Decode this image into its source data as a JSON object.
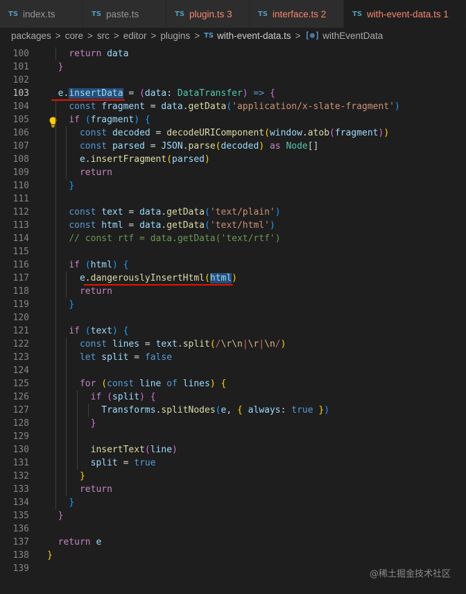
{
  "tabs": [
    {
      "label": "index.ts",
      "badge": "TS",
      "error": false,
      "active": false
    },
    {
      "label": "paste.ts",
      "badge": "TS",
      "error": false,
      "active": false
    },
    {
      "label": "plugin.ts 3",
      "badge": "TS",
      "error": true,
      "active": false
    },
    {
      "label": "interface.ts 2",
      "badge": "TS",
      "error": true,
      "active": false
    },
    {
      "label": "with-event-data.ts 1",
      "badge": "TS",
      "error": true,
      "active": true
    }
  ],
  "breadcrumb": {
    "parts": [
      "packages",
      "core",
      "src",
      "editor",
      "plugins"
    ],
    "separator": ">",
    "file_badge": "TS",
    "file": "with-event-data.ts",
    "symbol": "withEventData"
  },
  "editor": {
    "current_line": 103,
    "lines": [
      {
        "n": "100",
        "indent": 1,
        "tokens": [
          [
            "    ",
            ""
          ],
          [
            "return",
            "ctl"
          ],
          [
            " ",
            ""
          ],
          [
            "data",
            "v"
          ]
        ]
      },
      {
        "n": "101",
        "indent": 0,
        "tokens": [
          [
            "  ",
            ""
          ],
          [
            "}",
            "b2"
          ]
        ]
      },
      {
        "n": "102",
        "indent": 0,
        "tokens": []
      },
      {
        "n": "103",
        "indent": 0,
        "tokens": [
          [
            "  ",
            ""
          ],
          [
            "e",
            "v"
          ],
          [
            ".",
            ""
          ],
          [
            "insertData",
            "v hl"
          ],
          [
            " = ",
            ""
          ],
          [
            "(",
            "b2"
          ],
          [
            "data",
            "v"
          ],
          [
            ": ",
            ""
          ],
          [
            "DataTransfer",
            "ty"
          ],
          [
            ")",
            "b2"
          ],
          [
            " ",
            ""
          ],
          [
            "=>",
            "kw"
          ],
          [
            " ",
            ""
          ],
          [
            "{",
            "b2"
          ]
        ]
      },
      {
        "n": "104",
        "indent": 1,
        "tokens": [
          [
            "    ",
            ""
          ],
          [
            "const",
            "kw"
          ],
          [
            " ",
            ""
          ],
          [
            "fragment",
            "v"
          ],
          [
            " = ",
            ""
          ],
          [
            "data",
            "v"
          ],
          [
            ".",
            ""
          ],
          [
            "getData",
            "fn"
          ],
          [
            "(",
            "b3"
          ],
          [
            "'application/x-slate-fragment'",
            "str"
          ],
          [
            ")",
            "b3"
          ]
        ]
      },
      {
        "n": "105",
        "indent": 1,
        "tokens": [
          [
            "    ",
            ""
          ],
          [
            "if",
            "ctl"
          ],
          [
            " ",
            ""
          ],
          [
            "(",
            "b3"
          ],
          [
            "fragment",
            "v"
          ],
          [
            ")",
            "b3"
          ],
          [
            " ",
            ""
          ],
          [
            "{",
            "b3"
          ]
        ]
      },
      {
        "n": "106",
        "indent": 2,
        "tokens": [
          [
            "      ",
            ""
          ],
          [
            "const",
            "kw"
          ],
          [
            " ",
            ""
          ],
          [
            "decoded",
            "v"
          ],
          [
            " = ",
            ""
          ],
          [
            "decodeURIComponent",
            "fn"
          ],
          [
            "(",
            "b1"
          ],
          [
            "window",
            "v"
          ],
          [
            ".",
            ""
          ],
          [
            "atob",
            "fn"
          ],
          [
            "(",
            "b2"
          ],
          [
            "fragment",
            "v"
          ],
          [
            ")",
            "b2"
          ],
          [
            ")",
            "b1"
          ]
        ]
      },
      {
        "n": "107",
        "indent": 2,
        "tokens": [
          [
            "      ",
            ""
          ],
          [
            "const",
            "kw"
          ],
          [
            " ",
            ""
          ],
          [
            "parsed",
            "v"
          ],
          [
            " = ",
            ""
          ],
          [
            "JSON",
            "v"
          ],
          [
            ".",
            ""
          ],
          [
            "parse",
            "fn"
          ],
          [
            "(",
            "b1"
          ],
          [
            "decoded",
            "v"
          ],
          [
            ")",
            "b1"
          ],
          [
            " ",
            ""
          ],
          [
            "as",
            "ctl"
          ],
          [
            " ",
            ""
          ],
          [
            "Node",
            "ty"
          ],
          [
            "[]",
            ""
          ]
        ]
      },
      {
        "n": "108",
        "indent": 2,
        "tokens": [
          [
            "      ",
            ""
          ],
          [
            "e",
            "v"
          ],
          [
            ".",
            ""
          ],
          [
            "insertFragment",
            "fn"
          ],
          [
            "(",
            "b1"
          ],
          [
            "parsed",
            "v"
          ],
          [
            ")",
            "b1"
          ]
        ]
      },
      {
        "n": "109",
        "indent": 2,
        "tokens": [
          [
            "      ",
            ""
          ],
          [
            "return",
            "ctl"
          ]
        ]
      },
      {
        "n": "110",
        "indent": 1,
        "tokens": [
          [
            "    ",
            ""
          ],
          [
            "}",
            "b3"
          ]
        ]
      },
      {
        "n": "111",
        "indent": 1,
        "tokens": []
      },
      {
        "n": "112",
        "indent": 1,
        "tokens": [
          [
            "    ",
            ""
          ],
          [
            "const",
            "kw"
          ],
          [
            " ",
            ""
          ],
          [
            "text",
            "v"
          ],
          [
            " = ",
            ""
          ],
          [
            "data",
            "v"
          ],
          [
            ".",
            ""
          ],
          [
            "getData",
            "fn"
          ],
          [
            "(",
            "b3"
          ],
          [
            "'text/plain'",
            "str"
          ],
          [
            ")",
            "b3"
          ]
        ]
      },
      {
        "n": "113",
        "indent": 1,
        "tokens": [
          [
            "    ",
            ""
          ],
          [
            "const",
            "kw"
          ],
          [
            " ",
            ""
          ],
          [
            "html",
            "v"
          ],
          [
            " = ",
            ""
          ],
          [
            "data",
            "v"
          ],
          [
            ".",
            ""
          ],
          [
            "getData",
            "fn"
          ],
          [
            "(",
            "b3"
          ],
          [
            "'text/html'",
            "str"
          ],
          [
            ")",
            "b3"
          ]
        ]
      },
      {
        "n": "114",
        "indent": 1,
        "tokens": [
          [
            "    ",
            ""
          ],
          [
            "// const rtf = data.getData('text/rtf')",
            "cmt"
          ]
        ]
      },
      {
        "n": "115",
        "indent": 1,
        "tokens": []
      },
      {
        "n": "116",
        "indent": 1,
        "tokens": [
          [
            "    ",
            ""
          ],
          [
            "if",
            "ctl"
          ],
          [
            " ",
            ""
          ],
          [
            "(",
            "b3"
          ],
          [
            "html",
            "v"
          ],
          [
            ")",
            "b3"
          ],
          [
            " ",
            ""
          ],
          [
            "{",
            "b3"
          ]
        ]
      },
      {
        "n": "117",
        "indent": 2,
        "tokens": [
          [
            "      ",
            ""
          ],
          [
            "e",
            "v"
          ],
          [
            ".",
            ""
          ],
          [
            "dangerouslyInsertHtml",
            "fn"
          ],
          [
            "(",
            "b1"
          ],
          [
            "html",
            "v hl"
          ],
          [
            ")",
            "b1"
          ]
        ]
      },
      {
        "n": "118",
        "indent": 2,
        "tokens": [
          [
            "      ",
            ""
          ],
          [
            "return",
            "ctl"
          ]
        ]
      },
      {
        "n": "119",
        "indent": 1,
        "tokens": [
          [
            "    ",
            ""
          ],
          [
            "}",
            "b3"
          ]
        ]
      },
      {
        "n": "120",
        "indent": 1,
        "tokens": []
      },
      {
        "n": "121",
        "indent": 1,
        "tokens": [
          [
            "    ",
            ""
          ],
          [
            "if",
            "ctl"
          ],
          [
            " ",
            ""
          ],
          [
            "(",
            "b3"
          ],
          [
            "text",
            "v"
          ],
          [
            ")",
            "b3"
          ],
          [
            " ",
            ""
          ],
          [
            "{",
            "b3"
          ]
        ]
      },
      {
        "n": "122",
        "indent": 2,
        "tokens": [
          [
            "      ",
            ""
          ],
          [
            "const",
            "kw"
          ],
          [
            " ",
            ""
          ],
          [
            "lines",
            "v"
          ],
          [
            " = ",
            ""
          ],
          [
            "text",
            "v"
          ],
          [
            ".",
            ""
          ],
          [
            "split",
            "fn"
          ],
          [
            "(",
            "b1"
          ],
          [
            "/",
            "rx"
          ],
          [
            "\\r\\n",
            "esc"
          ],
          [
            "|",
            "rx"
          ],
          [
            "\\r",
            "esc"
          ],
          [
            "|",
            "rx"
          ],
          [
            "\\n",
            "esc"
          ],
          [
            "/",
            "rx"
          ],
          [
            ")",
            "b1"
          ]
        ]
      },
      {
        "n": "123",
        "indent": 2,
        "tokens": [
          [
            "      ",
            ""
          ],
          [
            "let",
            "kw"
          ],
          [
            " ",
            ""
          ],
          [
            "split",
            "v"
          ],
          [
            " = ",
            ""
          ],
          [
            "false",
            "kw"
          ]
        ]
      },
      {
        "n": "124",
        "indent": 2,
        "tokens": []
      },
      {
        "n": "125",
        "indent": 2,
        "tokens": [
          [
            "      ",
            ""
          ],
          [
            "for",
            "ctl"
          ],
          [
            " ",
            ""
          ],
          [
            "(",
            "b1"
          ],
          [
            "const",
            "kw"
          ],
          [
            " ",
            ""
          ],
          [
            "line",
            "v"
          ],
          [
            " ",
            ""
          ],
          [
            "of",
            "kw"
          ],
          [
            " ",
            ""
          ],
          [
            "lines",
            "v"
          ],
          [
            ")",
            "b1"
          ],
          [
            " ",
            ""
          ],
          [
            "{",
            "b1"
          ]
        ]
      },
      {
        "n": "126",
        "indent": 3,
        "tokens": [
          [
            "        ",
            ""
          ],
          [
            "if",
            "ctl"
          ],
          [
            " ",
            ""
          ],
          [
            "(",
            "b2"
          ],
          [
            "split",
            "v"
          ],
          [
            ")",
            "b2"
          ],
          [
            " ",
            ""
          ],
          [
            "{",
            "b2"
          ]
        ]
      },
      {
        "n": "127",
        "indent": 4,
        "tokens": [
          [
            "          ",
            ""
          ],
          [
            "Transforms",
            "v"
          ],
          [
            ".",
            ""
          ],
          [
            "splitNodes",
            "fn"
          ],
          [
            "(",
            "b3"
          ],
          [
            "e",
            "v"
          ],
          [
            ", ",
            ""
          ],
          [
            "{",
            "b1"
          ],
          [
            " ",
            ""
          ],
          [
            "always",
            "v"
          ],
          [
            ": ",
            ""
          ],
          [
            "true",
            "kw"
          ],
          [
            " ",
            ""
          ],
          [
            "}",
            "b1"
          ],
          [
            ")",
            "b3"
          ]
        ]
      },
      {
        "n": "128",
        "indent": 3,
        "tokens": [
          [
            "        ",
            ""
          ],
          [
            "}",
            "b2"
          ]
        ]
      },
      {
        "n": "129",
        "indent": 3,
        "tokens": []
      },
      {
        "n": "130",
        "indent": 3,
        "tokens": [
          [
            "        ",
            ""
          ],
          [
            "insertText",
            "fn"
          ],
          [
            "(",
            "b2"
          ],
          [
            "line",
            "v"
          ],
          [
            ")",
            "b2"
          ]
        ]
      },
      {
        "n": "131",
        "indent": 3,
        "tokens": [
          [
            "        ",
            ""
          ],
          [
            "split",
            "v"
          ],
          [
            " = ",
            ""
          ],
          [
            "true",
            "kw"
          ]
        ]
      },
      {
        "n": "132",
        "indent": 2,
        "tokens": [
          [
            "      ",
            ""
          ],
          [
            "}",
            "b1"
          ]
        ]
      },
      {
        "n": "133",
        "indent": 2,
        "tokens": [
          [
            "      ",
            ""
          ],
          [
            "return",
            "ctl"
          ]
        ]
      },
      {
        "n": "134",
        "indent": 1,
        "tokens": [
          [
            "    ",
            ""
          ],
          [
            "}",
            "b3"
          ]
        ]
      },
      {
        "n": "135",
        "indent": 0,
        "tokens": [
          [
            "  ",
            ""
          ],
          [
            "}",
            "b2"
          ]
        ]
      },
      {
        "n": "136",
        "indent": 0,
        "tokens": []
      },
      {
        "n": "137",
        "indent": 0,
        "tokens": [
          [
            "  ",
            ""
          ],
          [
            "return",
            "ctl"
          ],
          [
            " ",
            ""
          ],
          [
            "e",
            "v"
          ]
        ]
      },
      {
        "n": "138",
        "indent": 0,
        "tokens": [
          [
            "}",
            "b1"
          ]
        ]
      },
      {
        "n": "139",
        "indent": 0,
        "tokens": []
      }
    ]
  },
  "annotations": {
    "underlined_identifiers": [
      "e.insertData",
      "e.dangerouslyInsertHtml"
    ],
    "underline_color": "#e51400"
  },
  "lightbulb_icon": "lightbulb-icon",
  "watermark": "@稀土掘金技术社区",
  "colors": {
    "editor_bg": "#1e1e1e",
    "tab_bg": "#2d2d2d",
    "error_text": "#f48771",
    "ts_badge": "#519aba"
  }
}
